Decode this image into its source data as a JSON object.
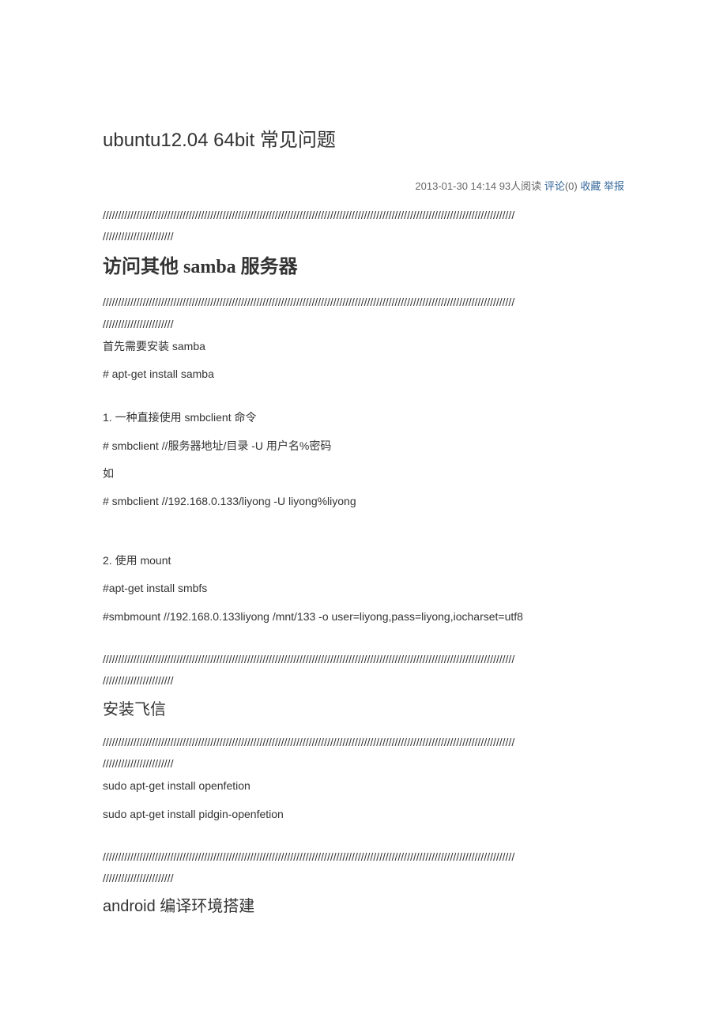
{
  "title": "ubuntu12.04 64bit 常见问题",
  "meta": {
    "datetime": "2013-01-30 14:14",
    "reads_count": "93",
    "reads_suffix": "人阅读",
    "comment_label": "评论",
    "comment_count": "(0)",
    "favorite": "收藏",
    "report": "举报"
  },
  "separator_long": "//////////////////////////////////////////////////////////////////////////////////////////////////////////////////////////////////////",
  "separator_short": "///////////////////////",
  "sections": {
    "samba": {
      "title": "访问其他 samba 服务器",
      "lines": {
        "l1": "首先需要安装 samba",
        "l2": "# apt-get install samba",
        "l3": "1.  一种直接使用 smbclient 命令",
        "l4": "# smbclient //服务器地址/目录  -U  用户名%密码",
        "l5": "如",
        "l6": "# smbclient //192.168.0.133/liyong -U liyong%liyong",
        "l7": "2.  使用 mount",
        "l8": "#apt-get install smbfs",
        "l9": "#smbmount //192.168.0.133liyong /mnt/133 -o user=liyong,pass=liyong,iocharset=utf8"
      }
    },
    "feixin": {
      "title": "安装飞信",
      "lines": {
        "l1": "sudo apt-get install openfetion",
        "l2": "sudo apt-get install pidgin-openfetion"
      }
    },
    "android": {
      "title": "android 编译环境搭建"
    }
  }
}
